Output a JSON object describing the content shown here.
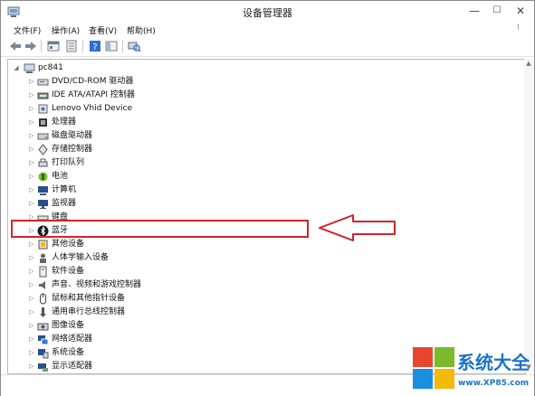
{
  "window": {
    "title": "设备管理器"
  },
  "titlebar_buttons": {
    "minimize": "—",
    "maximize": "☐",
    "close": "✕"
  },
  "menu": [
    {
      "label": "文件(F)"
    },
    {
      "label": "操作(A)"
    },
    {
      "label": "查看(V)"
    },
    {
      "label": "帮助(H)"
    }
  ],
  "toolbar": [
    {
      "icon": "back-arrow-icon"
    },
    {
      "icon": "forward-arrow-icon"
    },
    {
      "icon": "properties-pane-icon"
    },
    {
      "icon": "list-view-icon"
    },
    {
      "icon": "help-icon"
    },
    {
      "icon": "show-hide-console-tree-icon"
    },
    {
      "icon": "scan-hardware-icon"
    }
  ],
  "tree": {
    "root": {
      "label": "pc841",
      "expander": "◢",
      "icon": "computer-root-icon"
    },
    "items": [
      {
        "label": "DVD/CD-ROM 驱动器",
        "icon": "dvd-drive-icon"
      },
      {
        "label": "IDE ATA/ATAPI 控制器",
        "icon": "ide-controller-icon"
      },
      {
        "label": "Lenovo Vhid Device",
        "icon": "hid-device-icon"
      },
      {
        "label": "处理器",
        "icon": "processor-icon"
      },
      {
        "label": "磁盘驱动器",
        "icon": "disk-drive-icon"
      },
      {
        "label": "存储控制器",
        "icon": "storage-controller-icon"
      },
      {
        "label": "打印队列",
        "icon": "printer-icon"
      },
      {
        "label": "电池",
        "icon": "battery-icon"
      },
      {
        "label": "计算机",
        "icon": "computer-icon"
      },
      {
        "label": "监视器",
        "icon": "monitor-icon"
      },
      {
        "label": "键盘",
        "icon": "keyboard-icon"
      },
      {
        "label": "蓝牙",
        "icon": "bluetooth-icon"
      },
      {
        "label": "其他设备",
        "icon": "other-devices-icon"
      },
      {
        "label": "人体学输入设备",
        "icon": "human-interface-device-icon"
      },
      {
        "label": "软件设备",
        "icon": "software-device-icon"
      },
      {
        "label": "声音、视频和游戏控制器",
        "icon": "sound-icon"
      },
      {
        "label": "鼠标和其他指针设备",
        "icon": "mouse-icon"
      },
      {
        "label": "通用串行总线控制器",
        "icon": "usb-controller-icon"
      },
      {
        "label": "图像设备",
        "icon": "imaging-device-icon"
      },
      {
        "label": "网络适配器",
        "icon": "network-adapter-icon"
      },
      {
        "label": "系统设备",
        "icon": "system-devices-icon"
      },
      {
        "label": "显示适配器",
        "icon": "display-adapter-icon"
      }
    ],
    "collapsed_expander": "▷"
  },
  "annotation": {
    "highlighted_item": "蓝牙",
    "color": "#d0252b"
  },
  "watermark": {
    "brand_text": "系统大全",
    "url": "www.XP85.com",
    "brand_color": "#1a74c7"
  }
}
